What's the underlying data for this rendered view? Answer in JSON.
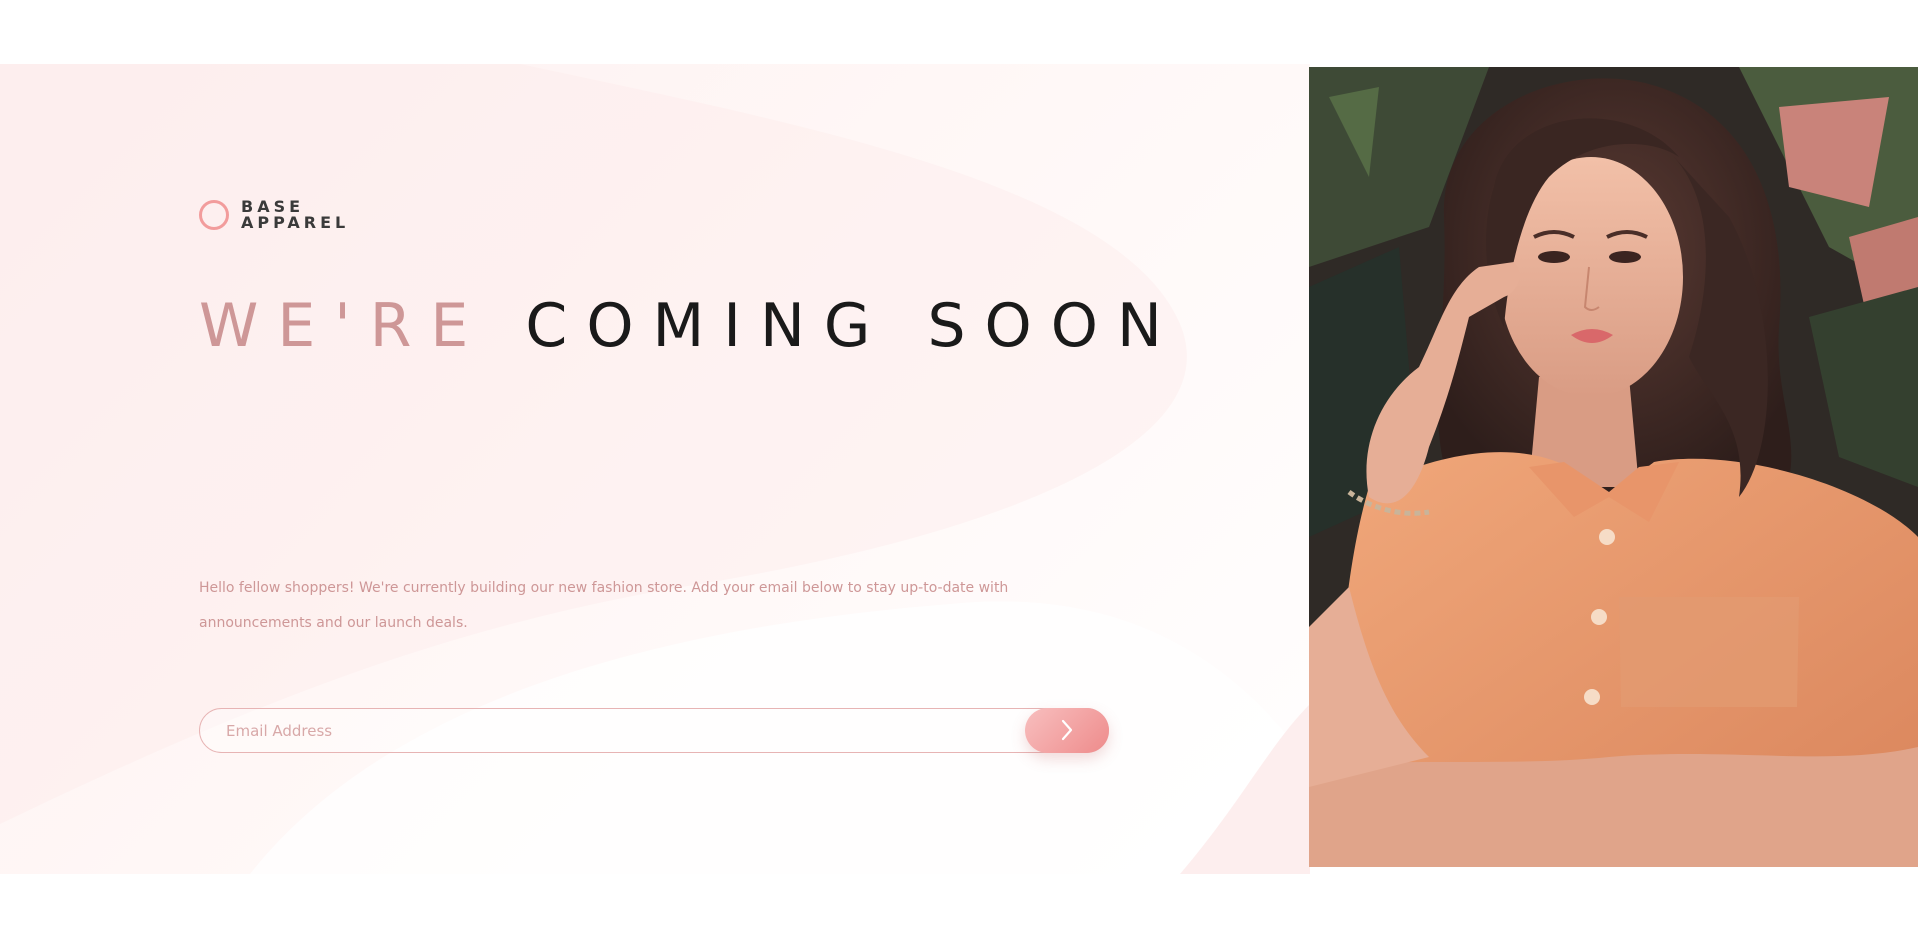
{
  "brand": {
    "line1": "BASE",
    "line2": "APPAREL",
    "accent_color": "#f29c9c"
  },
  "hero": {
    "headline_light": "WE'RE",
    "headline_dark": "COMING SOON",
    "description": "Hello fellow shoppers! We're currently building our new fashion store. Add your email below to stay up-to-date with announcements and our launch deals."
  },
  "form": {
    "email_placeholder": "Email Address",
    "submit_icon": "chevron-right-icon"
  },
  "image": {
    "subject": "woman-in-orange-shirt-photo"
  },
  "colors": {
    "text_light": "#ce9797",
    "text_dark": "#1a1a1a",
    "button_start": "#f8bfbf",
    "button_end": "#ee8b8b"
  }
}
